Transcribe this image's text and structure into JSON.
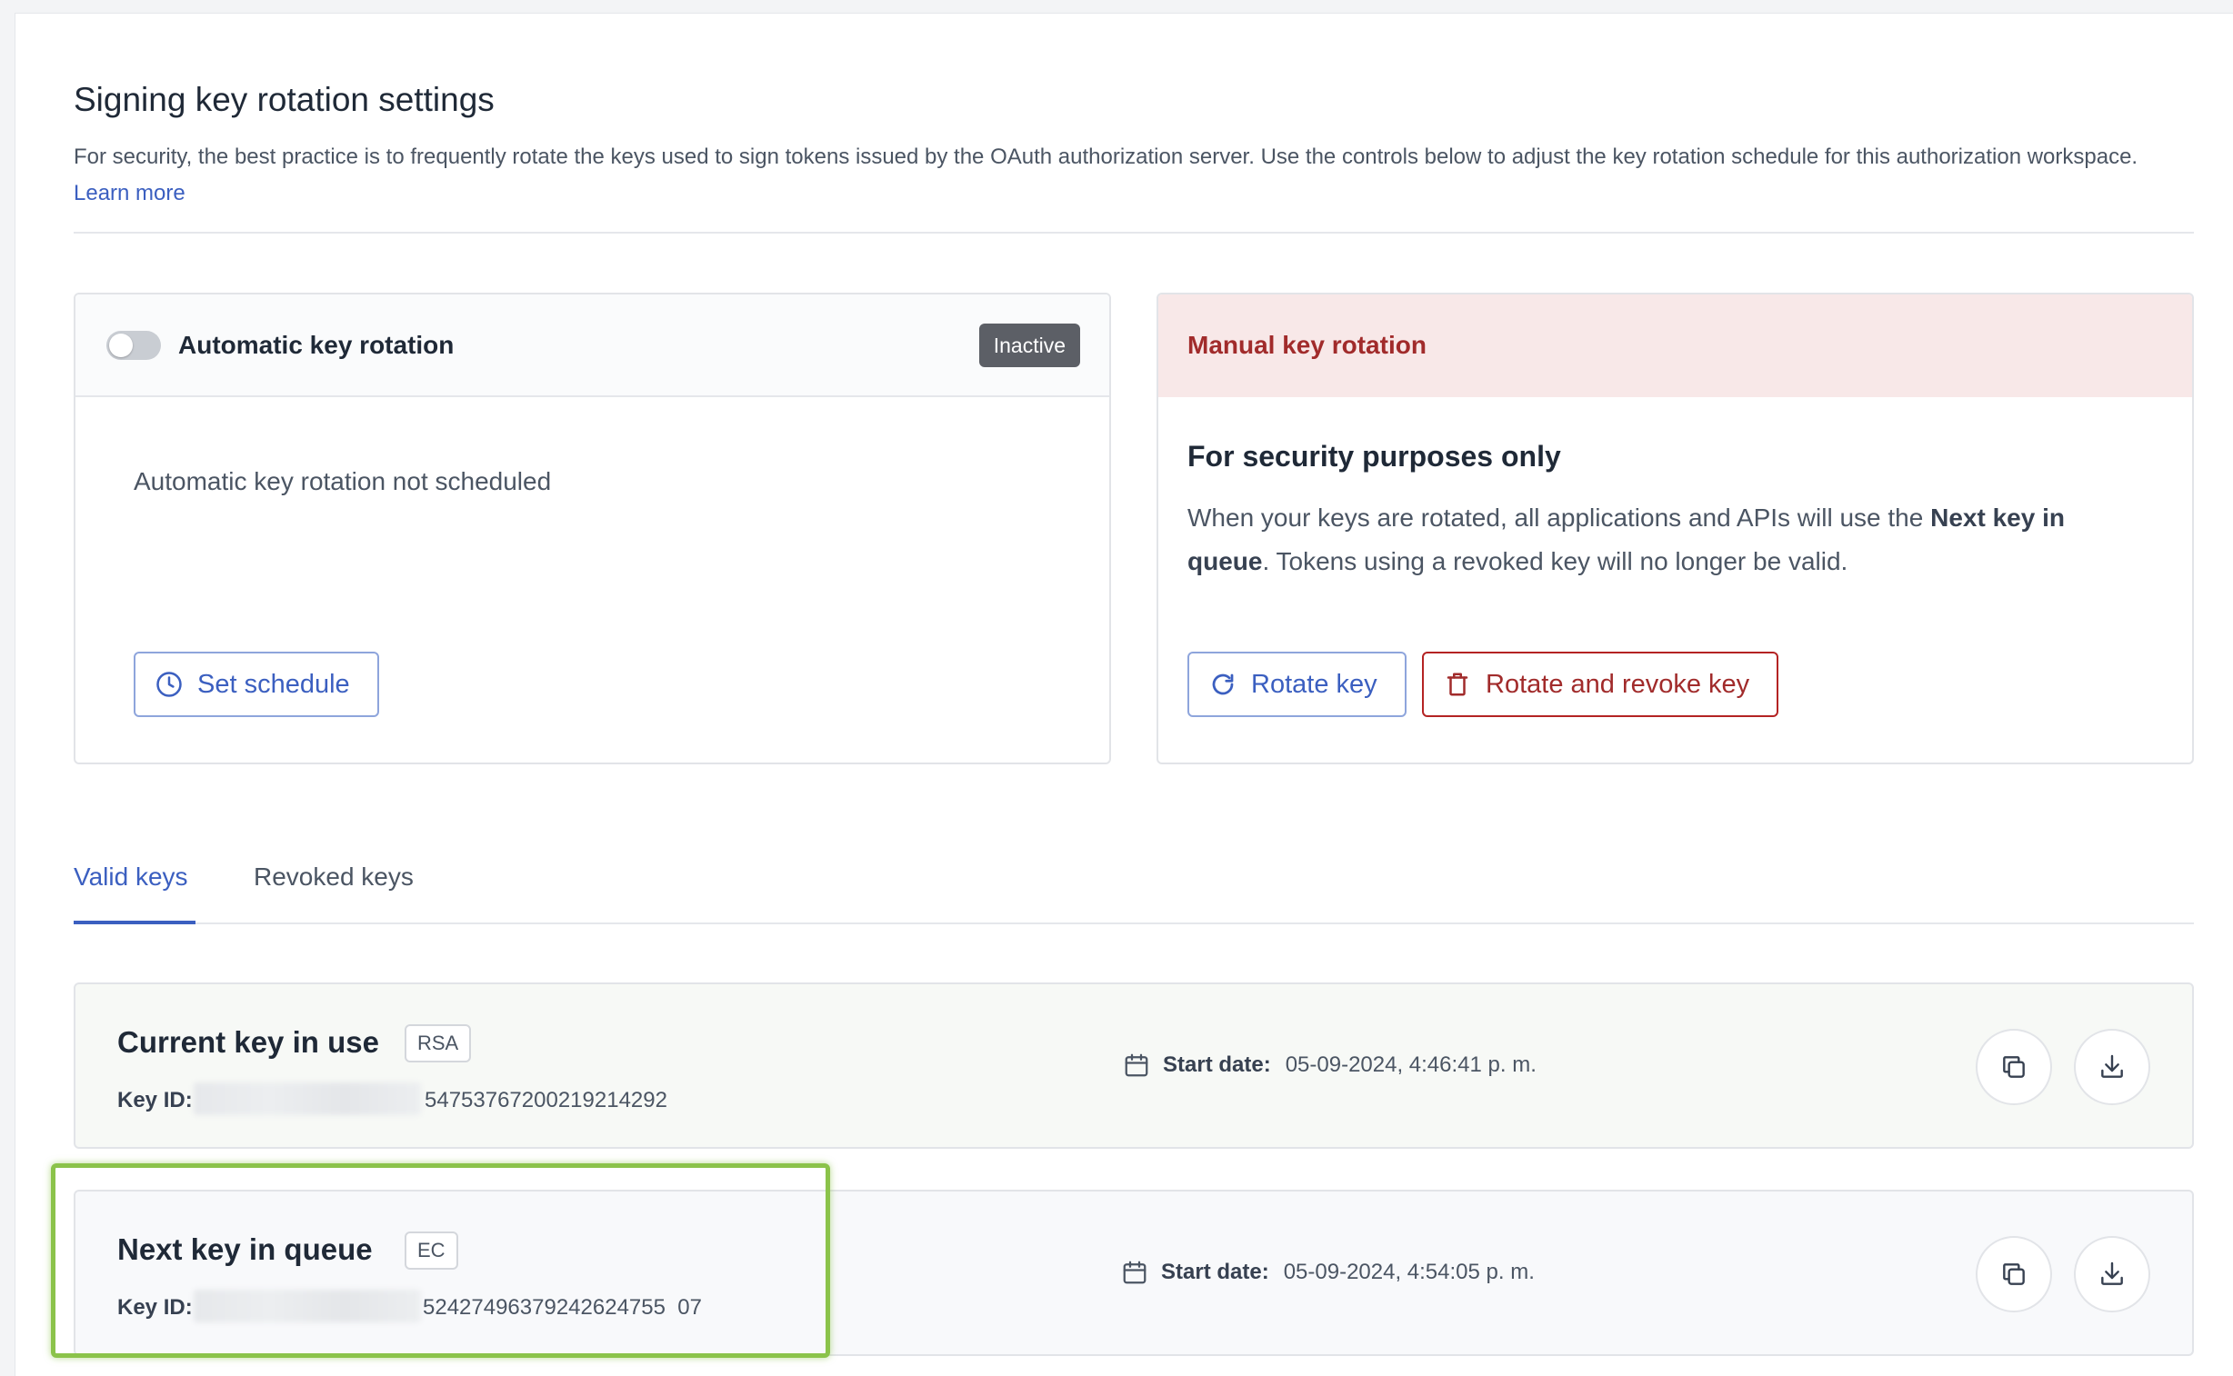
{
  "header": {
    "title": "Signing key rotation settings",
    "description": "For security, the best practice is to frequently rotate the keys used to sign tokens issued by the OAuth authorization server. Use the controls below to adjust the key rotation schedule for this authorization workspace.",
    "learn_more": "Learn more"
  },
  "auto_rotation": {
    "title": "Automatic key rotation",
    "status_badge": "Inactive",
    "enabled": false,
    "message": "Automatic key rotation not scheduled",
    "set_schedule_label": "Set schedule"
  },
  "manual_rotation": {
    "title": "Manual key rotation",
    "heading": "For security purposes only",
    "text_before": "When your keys are rotated, all applications and APIs will use the ",
    "text_bold": "Next key in queue",
    "text_after": ". Tokens using a revoked key will no longer be valid.",
    "rotate_label": "Rotate key",
    "rotate_revoke_label": "Rotate and revoke key"
  },
  "tabs": [
    {
      "label": "Valid keys",
      "active": true
    },
    {
      "label": "Revoked keys",
      "active": false
    }
  ],
  "keys": [
    {
      "title": "Current key in use",
      "algorithm": "RSA",
      "key_id_label": "Key ID:",
      "key_id_visible": "54753767200219214292",
      "start_date_label": "Start date:",
      "start_date": "05-09-2024, 4:46:41 p. m."
    },
    {
      "title": "Next key in queue",
      "algorithm": "EC",
      "key_id_label": "Key ID:",
      "key_id_visible": "52427496379242624755 07",
      "start_date_label": "Start date:",
      "start_date": "05-09-2024, 4:54:05 p. m."
    }
  ],
  "colors": {
    "accent": "#3b5fc0",
    "danger": "#a12b2b",
    "badge_bg": "#5c5f66",
    "highlight": "#8bc34a"
  }
}
